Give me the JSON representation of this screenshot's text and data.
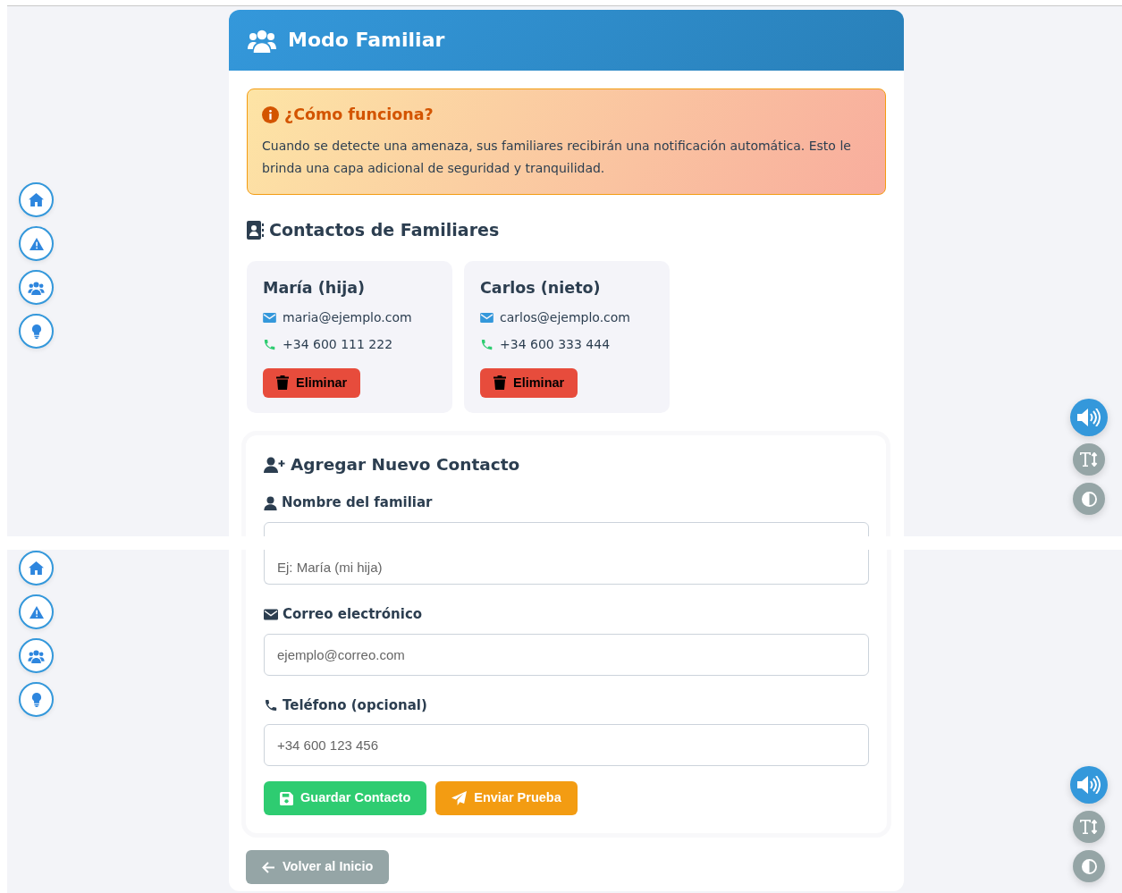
{
  "views": [
    {
      "side_nav": [
        {
          "kind": "home"
        },
        {
          "kind": "alert"
        },
        {
          "kind": "family"
        },
        {
          "kind": "tip"
        }
      ],
      "tools": [
        {
          "kind": "sound",
          "on": true
        },
        {
          "kind": "text_size",
          "on": false
        },
        {
          "kind": "contrast",
          "on": false
        }
      ],
      "header": {
        "title": "Modo Familiar"
      },
      "info": {
        "title": "¿Cómo funciona?",
        "text": "Cuando se detecte una amenaza, sus familiares recibirán una notificación automática. Esto le brinda una capa adicional de seguridad y tranquilidad."
      },
      "contacts_title": "Contactos de Familiares",
      "contacts": [
        {
          "name": "María (hija)",
          "email": "maria@ejemplo.com",
          "phone": "+34 600 111 222",
          "delete_label": "Eliminar"
        },
        {
          "name": "Carlos (nieto)",
          "email": "carlos@ejemplo.com",
          "phone": "+34 600 333 444",
          "delete_label": "Eliminar"
        }
      ],
      "form": {
        "title": "Agregar Nuevo Contacto",
        "fields": [
          {
            "kind": "name",
            "label": "Nombre del familiar"
          }
        ]
      }
    },
    {
      "side_nav": [
        {
          "kind": "home"
        },
        {
          "kind": "alert"
        },
        {
          "kind": "family"
        },
        {
          "kind": "tip"
        }
      ],
      "tools": [
        {
          "kind": "sound",
          "on": true
        },
        {
          "kind": "text_size",
          "on": false
        },
        {
          "kind": "contrast",
          "on": false
        }
      ],
      "form": {
        "fields": [
          {
            "kind": "name",
            "placeholder": "Ej: María (mi hija)"
          },
          {
            "kind": "email",
            "label": "Correo electrónico",
            "placeholder": "ejemplo@correo.com"
          },
          {
            "kind": "phone",
            "label": "Teléfono (opcional)",
            "placeholder": "+34 600 123 456"
          }
        ],
        "buttons": [
          {
            "kind": "save",
            "label": "Guardar Contacto"
          },
          {
            "kind": "test",
            "label": "Enviar Prueba"
          }
        ]
      },
      "back_button": "Volver al Inicio"
    }
  ]
}
